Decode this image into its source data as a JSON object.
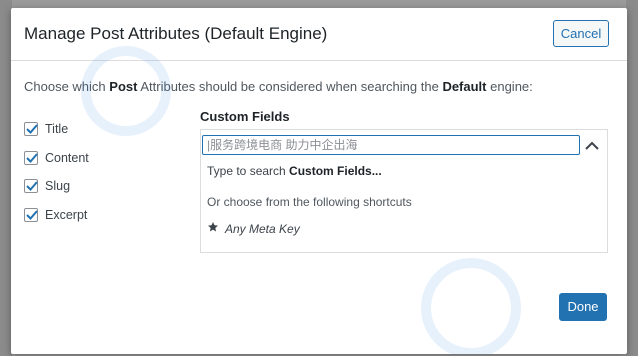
{
  "modal": {
    "title": "Manage Post Attributes (Default Engine)",
    "cancel_label": "Cancel",
    "done_label": "Done",
    "intro": {
      "prefix": "Choose which ",
      "bold1": "Post",
      "middle": " Attributes should be considered when searching the ",
      "bold2": "Default",
      "suffix": " engine:"
    }
  },
  "attributes": [
    {
      "label": "Title",
      "checked": true
    },
    {
      "label": "Content",
      "checked": true
    },
    {
      "label": "Slug",
      "checked": true
    },
    {
      "label": "Excerpt",
      "checked": true
    }
  ],
  "custom_fields": {
    "label": "Custom Fields",
    "input_value": "|服务跨境电商 助力中企出海",
    "hint_prefix": "Type to search ",
    "hint_bold": "Custom Fields...",
    "shortcut_note": "Or choose from the following shortcuts",
    "shortcut_label": "Any Meta Key",
    "shortcut_icon": "star-icon"
  },
  "colors": {
    "accent": "#2271b1",
    "backdrop": "#9a9a9a"
  }
}
